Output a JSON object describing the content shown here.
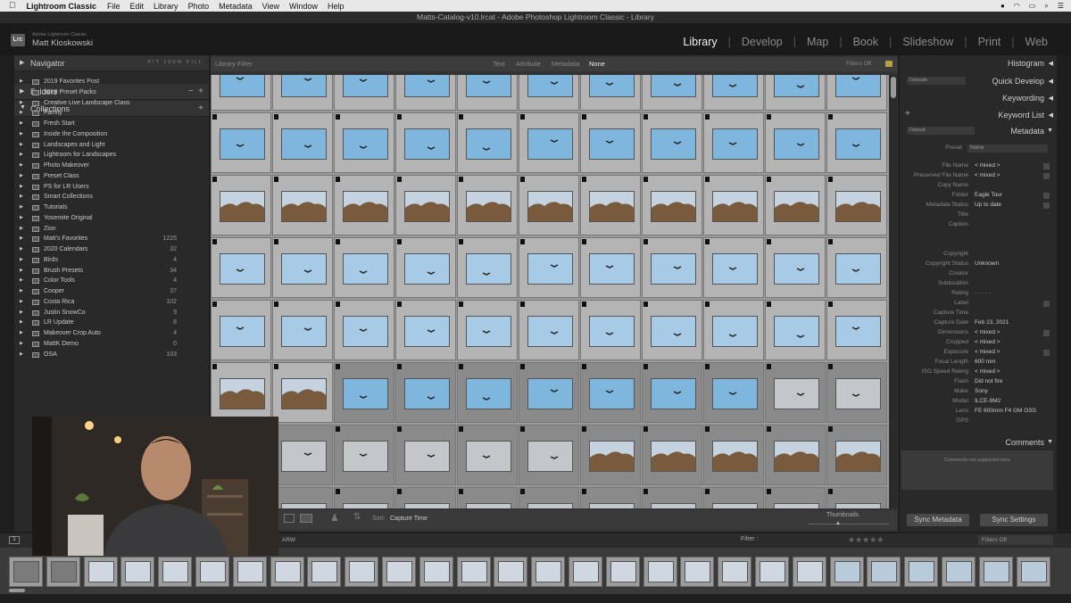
{
  "menubar": {
    "app_name": "Lightroom Classic",
    "menus": [
      "File",
      "Edit",
      "Library",
      "Photo",
      "Metadata",
      "View",
      "Window",
      "Help"
    ],
    "clock": "..."
  },
  "window_title": "Matts-Catalog-v10.lrcat - Adobe Photoshop Lightroom Classic - Library",
  "identity": {
    "product": "Adobe Lightroom Classic",
    "user": "Matt Kloskowski",
    "logo": "Lrc"
  },
  "modules": [
    "Library",
    "Develop",
    "Map",
    "Book",
    "Slideshow",
    "Print",
    "Web"
  ],
  "active_module": "Library",
  "left_panel": {
    "navigator": {
      "title": "Navigator",
      "zoom_options": [
        "FIT",
        "100%",
        "FILL"
      ]
    },
    "folders": {
      "title": "Folders"
    },
    "collections": {
      "title": "Collections",
      "items": [
        {
          "name": "2019 Favorites Post",
          "count": ""
        },
        {
          "name": "2019 Preset Packs",
          "count": ""
        },
        {
          "name": "Creative Live Landscape Class",
          "count": ""
        },
        {
          "name": "Family",
          "count": ""
        },
        {
          "name": "Fresh Start",
          "count": ""
        },
        {
          "name": "Inside the Composition",
          "count": ""
        },
        {
          "name": "Landscapes and Light",
          "count": ""
        },
        {
          "name": "Lightroom for Landscapes",
          "count": ""
        },
        {
          "name": "Photo Makeover",
          "count": ""
        },
        {
          "name": "Preset Class",
          "count": ""
        },
        {
          "name": "PS for LR Users",
          "count": ""
        },
        {
          "name": "Smart Collections",
          "count": ""
        },
        {
          "name": "Tutorials",
          "count": ""
        },
        {
          "name": "Yosemite Original",
          "count": ""
        },
        {
          "name": "Zion",
          "count": ""
        },
        {
          "name": "Matt's Favorites",
          "count": "1225"
        },
        {
          "name": "2020 Calendars",
          "count": "32"
        },
        {
          "name": "Birds",
          "count": "4"
        },
        {
          "name": "Brush Presets",
          "count": "34"
        },
        {
          "name": "Color Tools",
          "count": "4"
        },
        {
          "name": "Cooper",
          "count": "37"
        },
        {
          "name": "Costa Rica",
          "count": "102"
        },
        {
          "name": "Justin SnowCo",
          "count": "9"
        },
        {
          "name": "LR Update",
          "count": "8"
        },
        {
          "name": "Makeover Crop Auto",
          "count": "4"
        },
        {
          "name": "MattK Demo",
          "count": "0"
        },
        {
          "name": "OSA",
          "count": "103"
        }
      ]
    }
  },
  "library_filter": {
    "label": "Library Filter",
    "options": [
      "Text",
      "Attribute",
      "Metadata",
      "None"
    ],
    "active": "None",
    "preset": "Filters Off"
  },
  "toolbar": {
    "sort_label": "Sort:",
    "sort_value": "Capture Time",
    "thumbnails_label": "Thumbnails"
  },
  "right_panel": {
    "histogram": "Histogram",
    "quick_develop": {
      "title": "Quick Develop",
      "preset": "Defaults"
    },
    "keywording": "Keywording",
    "keyword_list": "Keyword List",
    "metadata": {
      "title": "Metadata",
      "preset_label": "Preset",
      "preset_value": "None",
      "dropdown": "Default",
      "rows": [
        {
          "k": "File Name",
          "v": "< mixed >"
        },
        {
          "k": "Preserved File Name",
          "v": "< mixed >"
        },
        {
          "k": "Copy Name",
          "v": ""
        },
        {
          "k": "Folder",
          "v": "Eagle Tour"
        },
        {
          "k": "Metadata Status",
          "v": "Up to date"
        },
        {
          "k": "Title",
          "v": ""
        },
        {
          "k": "Caption",
          "v": ""
        },
        {
          "k": "",
          "v": ""
        },
        {
          "k": "",
          "v": ""
        },
        {
          "k": "Copyright",
          "v": ""
        },
        {
          "k": "Copyright Status",
          "v": "Unknown"
        },
        {
          "k": "Creator",
          "v": ""
        },
        {
          "k": "Sublocation",
          "v": ""
        },
        {
          "k": "Rating",
          "v": "· · · · ·"
        },
        {
          "k": "Label",
          "v": ""
        },
        {
          "k": "Capture Time",
          "v": ""
        },
        {
          "k": "Capture Date",
          "v": "Feb 23, 2021"
        },
        {
          "k": "Dimensions",
          "v": "< mixed >"
        },
        {
          "k": "Cropped",
          "v": "< mixed >"
        },
        {
          "k": "Exposure",
          "v": "< mixed >"
        },
        {
          "k": "Focal Length",
          "v": "600 mm"
        },
        {
          "k": "ISO Speed Rating",
          "v": "< mixed >"
        },
        {
          "k": "Flash",
          "v": "Did not fire"
        },
        {
          "k": "Make",
          "v": "Sony"
        },
        {
          "k": "Model",
          "v": "ILCE-9M2"
        },
        {
          "k": "Lens",
          "v": "FE 600mm F4 GM OSS"
        },
        {
          "k": "GPS",
          "v": ""
        }
      ]
    },
    "comments": {
      "title": "Comments",
      "note": "Comments not supported here"
    },
    "sync_metadata": "Sync Metadata",
    "sync_settings": "Sync Settings"
  },
  "filmstrip": {
    "source": "ARW",
    "filter_label": "Filter :",
    "filter_value": "Filters Off",
    "page": "1"
  },
  "colors": {
    "sky": "#7fb6de",
    "sky_light": "#a7cbe6",
    "nest": "#8d6b4c",
    "overcast": "#c3c7cc",
    "panel": "#292929",
    "accent": "#f2f2f2"
  }
}
